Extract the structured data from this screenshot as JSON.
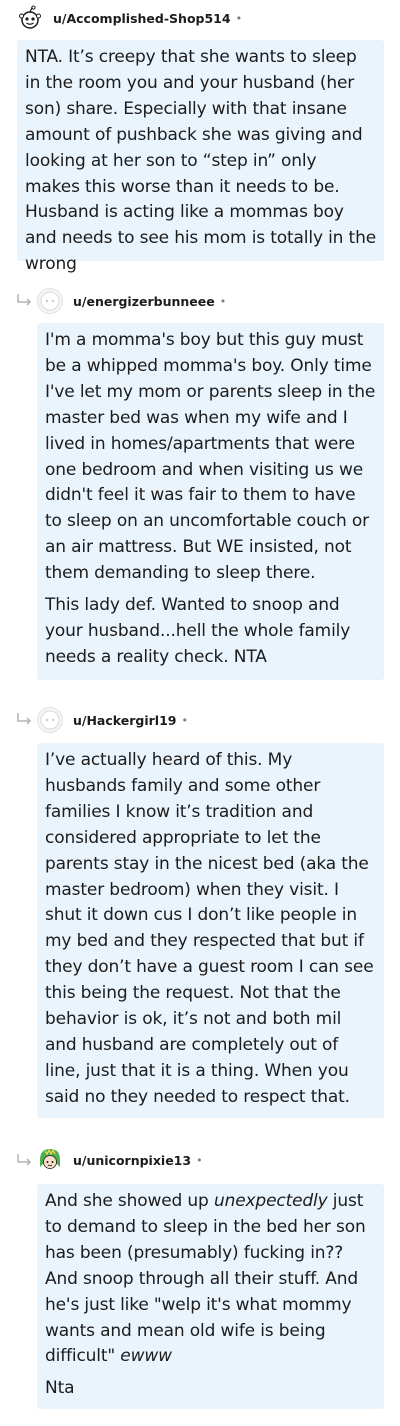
{
  "comments": [
    {
      "username": "u/Accomplished-Shop514",
      "separator": "•",
      "avatar_icon": "reddit-snoo-icon",
      "paragraphs": [
        "NTA. It’s creepy that she wants to sleep in the room you and your husband (her son) share. Especially with that insane amount of pushback she was giving and looking at her son to “step in” only makes this worse than it needs to be. Husband is acting like a mommas boy and needs to see his mom is totally in the wrong"
      ]
    },
    {
      "username": "u/energizerbunneee",
      "separator": "•",
      "avatar_icon": "default-avatar-icon",
      "paragraphs": [
        "I'm a momma's boy but this guy must be a whipped momma's boy. Only time I've let my mom or parents sleep in the master bed was when my wife and I lived in homes/apartments that were one bedroom and when visiting us we didn't feel it was fair to them to have to sleep on an uncomfortable couch or an air mattress. But WE insisted, not them demanding to sleep there.",
        "This lady def. Wanted to snoop and your husband...hell the whole family needs a reality check. NTA"
      ]
    },
    {
      "username": "u/Hackergirl19",
      "separator": "•",
      "avatar_icon": "default-avatar-icon",
      "paragraphs": [
        "I’ve actually heard of this. My husbands family and some other families I know it’s tradition and considered appropriate to let the parents stay in the nicest bed (aka the master bedroom) when they visit. I shut it down cus I don’t like people in my bed and they respected that but if they don’t have a guest room I can see this being the request. Not that the behavior is ok, it’s not and both mil and husband are completely out of line, just that it is a thing. When you said no they needed to respect that."
      ]
    },
    {
      "username": "u/unicornpixie13",
      "separator": "•",
      "avatar_icon": "green-haired-avatar-icon",
      "p1_a": "And she showed up ",
      "p1_em": "unexpectedly",
      "p1_b": " just to demand to sleep in the bed her son has been (presumably) fucking in?? And snoop through all their stuff. And he's just like \"welp it's what mommy wants and mean old wife is being difficult\" ",
      "p1_em2": "ewww",
      "p2": "Nta"
    }
  ],
  "colors": {
    "bubble": "#eaf4fc",
    "text": "#1c1c1c",
    "meta": "#7c7c7c"
  }
}
